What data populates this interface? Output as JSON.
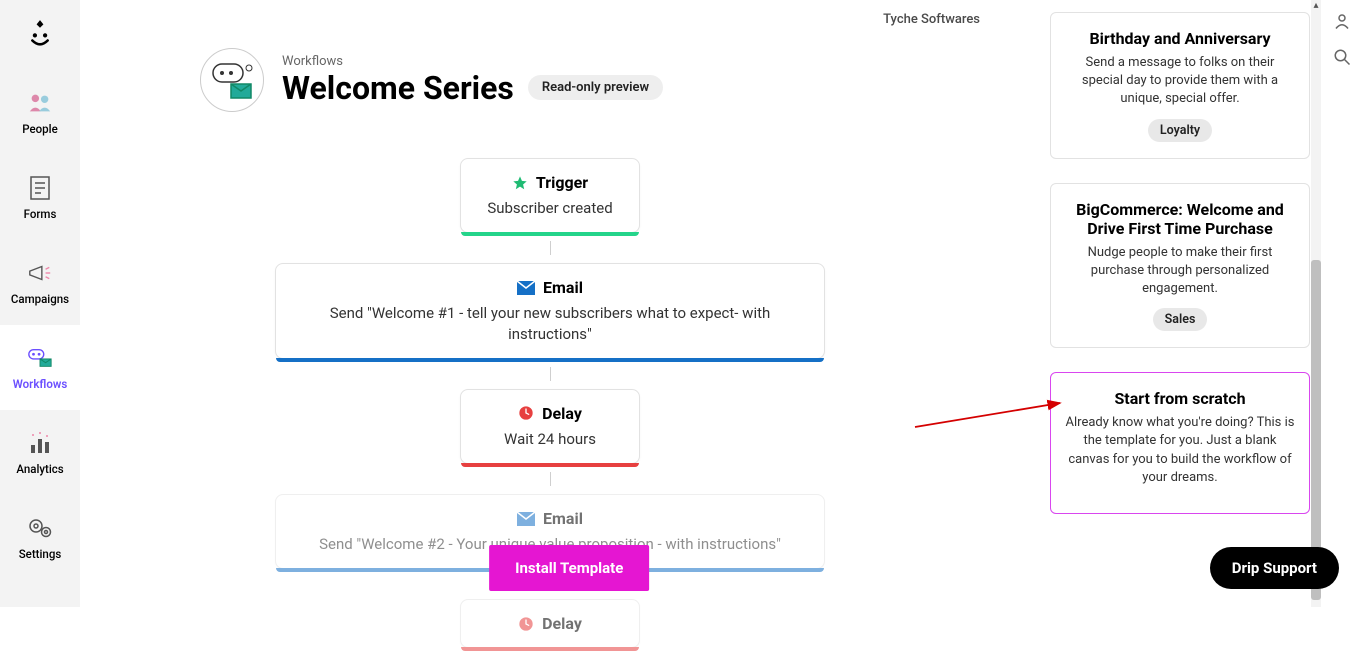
{
  "brand": "Tyche Softwares",
  "left_nav": {
    "items": [
      {
        "label": "People"
      },
      {
        "label": "Forms"
      },
      {
        "label": "Campaigns"
      },
      {
        "label": "Workflows"
      },
      {
        "label": "Analytics"
      },
      {
        "label": "Settings"
      }
    ]
  },
  "header": {
    "breadcrumb": "Workflows",
    "title": "Welcome Series",
    "badge": "Read-only preview"
  },
  "nodes": {
    "trigger": {
      "label": "Trigger",
      "body": "Subscriber created"
    },
    "email1": {
      "label": "Email",
      "body": "Send \"Welcome #1 - tell your new subscribers what to expect- with instructions\""
    },
    "delay1": {
      "label": "Delay",
      "body": "Wait 24 hours"
    },
    "email2": {
      "label": "Email",
      "body": "Send \"Welcome #2 - Your unique value proposition - with instructions\""
    },
    "delay2": {
      "label": "Delay"
    }
  },
  "templates": {
    "birthday": {
      "title": "Birthday and Anniversary",
      "desc": "Send a message to folks on their special day to provide them with a unique, special offer.",
      "tag": "Loyalty"
    },
    "bigcommerce": {
      "title": "BigCommerce: Welcome and Drive First Time Purchase",
      "desc": "Nudge people to make their first purchase through personalized engagement.",
      "tag": "Sales"
    },
    "scratch": {
      "title": "Start from scratch",
      "desc": "Already know what you're doing? This is the template for you. Just a blank canvas for you to build the workflow of your dreams."
    }
  },
  "buttons": {
    "install": "Install Template",
    "support": "Drip Support"
  }
}
